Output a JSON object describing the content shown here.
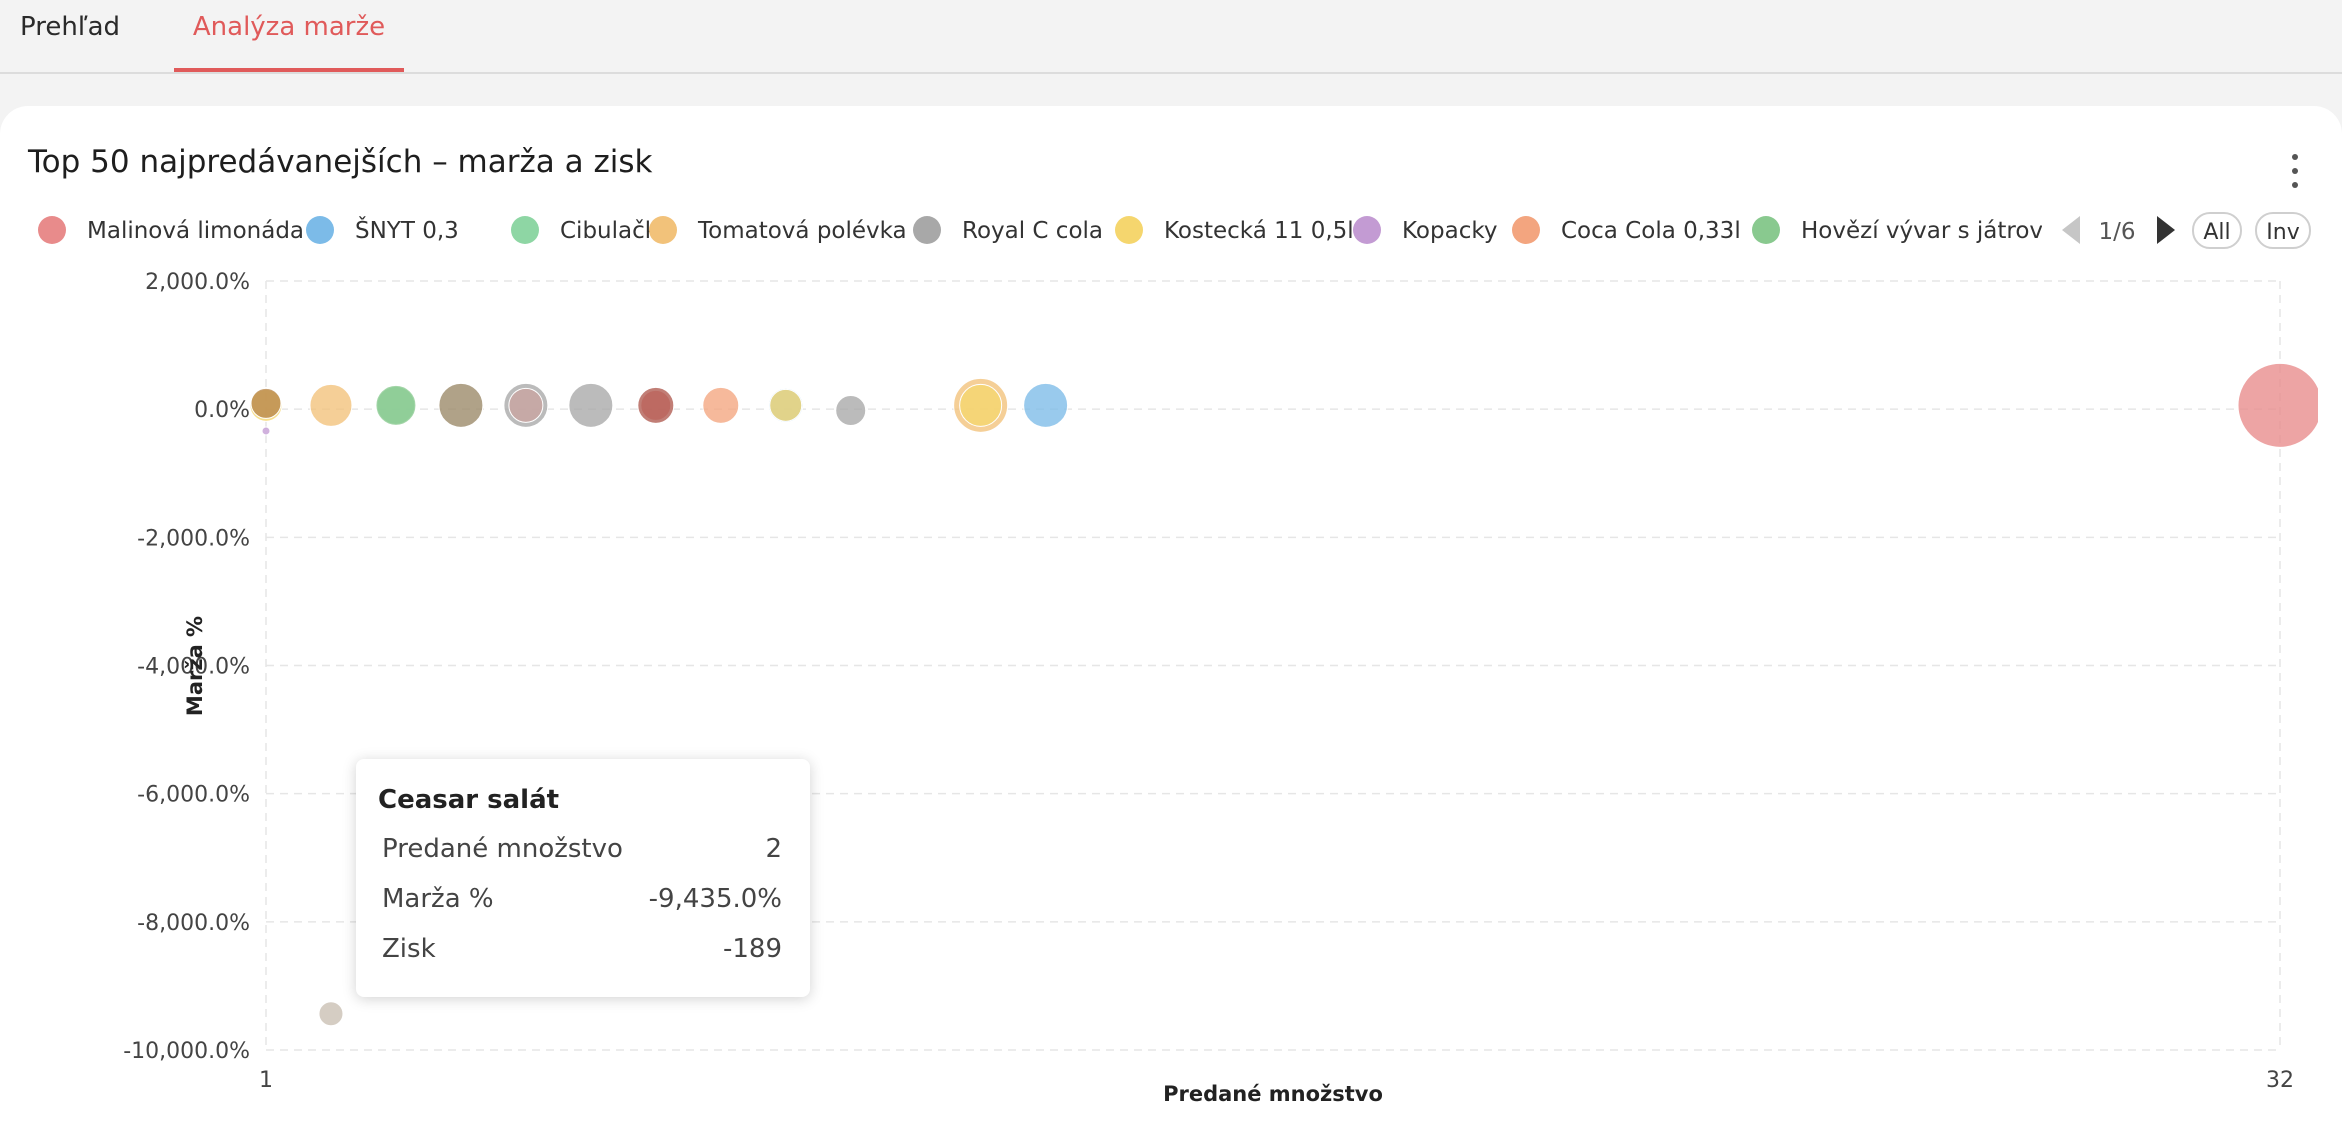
{
  "tabs": [
    {
      "label": "Prehľad",
      "active": false
    },
    {
      "label": "Analýza marže",
      "active": true
    }
  ],
  "accent_color": "#e05a5a",
  "card": {
    "menu_icon": "more-vertical-icon"
  },
  "legend": {
    "page": "1/6",
    "all_label": "All",
    "inv_label": "Inv"
  },
  "tooltip": {
    "title": "Ceasar salát",
    "rows": [
      {
        "label": "Predané množstvo",
        "value": "2"
      },
      {
        "label": "Marža %",
        "value": "-9,435.0%"
      },
      {
        "label": "Zisk",
        "value": "-189"
      }
    ]
  },
  "chart_data": {
    "type": "scatter",
    "title": "Top 50 najpredávanejších – marža a zisk",
    "xlabel": "Predané množstvo",
    "ylabel": "Marža %",
    "xlim": [
      1,
      32
    ],
    "ylim": [
      -10000,
      2000
    ],
    "x_ticks": [
      "1",
      "32"
    ],
    "y_ticks": [
      {
        "value": 2000,
        "label": "2,000.0%"
      },
      {
        "value": 0,
        "label": "0.0%"
      },
      {
        "value": -2000,
        "label": "-2,000.0%"
      },
      {
        "value": -4000,
        "label": "-4,000.0%"
      },
      {
        "value": -6000,
        "label": "-6,000.0%"
      },
      {
        "value": -8000,
        "label": "-8,000.0%"
      },
      {
        "value": -10000,
        "label": "-10,000.0%"
      }
    ],
    "grid": true,
    "legend_position": "top",
    "size_encodes": "Zisk",
    "series": [
      {
        "name": "Malinová limonáda",
        "color": "#e88b8b",
        "points": [
          {
            "x": 32,
            "y": 60,
            "size": 42
          },
          {
            "x": 7,
            "y": 60,
            "size": 15
          }
        ]
      },
      {
        "name": "ŠNYT 0,3",
        "color": "#7cbbe8",
        "points": [
          {
            "x": 13,
            "y": 60,
            "size": 22
          },
          {
            "x": 9,
            "y": 60,
            "size": 17
          }
        ]
      },
      {
        "name": "Cibulačka",
        "color": "#8ed6a4",
        "points": [
          {
            "x": 3,
            "y": 60,
            "size": 19
          }
        ]
      },
      {
        "name": "Tomatová polévka",
        "color": "#f2c27a",
        "points": [
          {
            "x": 2,
            "y": 60,
            "size": 21
          },
          {
            "x": 12,
            "y": 60,
            "size": 27
          }
        ]
      },
      {
        "name": "Royal C cola",
        "color": "#a8a8a8",
        "points": [
          {
            "x": 5,
            "y": 60,
            "size": 22
          },
          {
            "x": 10,
            "y": -20,
            "size": 15
          },
          {
            "x": 6,
            "y": 60,
            "size": 22
          }
        ]
      },
      {
        "name": "Kostecká 11 0,5l",
        "color": "#f5d66e",
        "points": [
          {
            "x": 1,
            "y": 60,
            "size": 16
          },
          {
            "x": 9,
            "y": 60,
            "size": 16
          },
          {
            "x": 12,
            "y": 60,
            "size": 21
          }
        ]
      },
      {
        "name": "Kopacky",
        "color": "#c39bd3",
        "points": [
          {
            "x": 1,
            "y": -340,
            "size": 4
          }
        ]
      },
      {
        "name": "Coca Cola 0,33l",
        "color": "#f3a57f",
        "points": [
          {
            "x": 8,
            "y": 60,
            "size": 18
          }
        ]
      },
      {
        "name": "Hovězí vývar s játrovými knedlíčky",
        "color": "#89c98f",
        "points": [
          {
            "x": 3,
            "y": 60,
            "size": 20
          }
        ]
      },
      {
        "name": "Ceasar salát",
        "color": "#c9bfb2",
        "points": [
          {
            "x": 2,
            "y": -9435,
            "size": 12
          }
        ]
      },
      {
        "name": "",
        "color": "#9a8866",
        "points": [
          {
            "x": 4,
            "y": 60,
            "size": 22
          }
        ]
      },
      {
        "name": "",
        "color": "#b05a50",
        "points": [
          {
            "x": 7,
            "y": 60,
            "size": 18
          }
        ]
      },
      {
        "name": "",
        "color": "#b8874a",
        "points": [
          {
            "x": 1,
            "y": 90,
            "size": 15
          }
        ]
      },
      {
        "name": "",
        "color": "#c9a4a0",
        "points": [
          {
            "x": 5,
            "y": 60,
            "size": 17
          }
        ]
      }
    ]
  }
}
